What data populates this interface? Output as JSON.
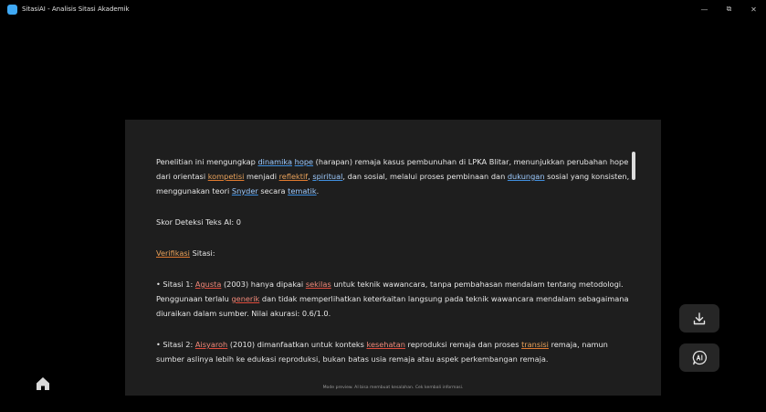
{
  "window": {
    "title": "SitasiAI - Analisis Sitasi Akademik",
    "minimize": "—",
    "maximize": "⧉",
    "close": "✕"
  },
  "content": {
    "p1": {
      "t1": "Penelitian ini mengungkap ",
      "w1": "dinamika",
      "t2": " ",
      "w2": "hope",
      "t3": " (harapan) remaja kasus pembunuhan di LPKA Blitar, menunjukkan perubahan hope dari orientasi ",
      "w3": "kompetisi",
      "t4": " menjadi ",
      "w4": "reflektif",
      "t5": ", ",
      "w5": "spiritual",
      "t6": ", dan sosial, melalui proses pembinaan dan ",
      "w6": "dukungan",
      "t7": " sosial yang konsisten, menggunakan teori ",
      "w7": "Snyder",
      "t8": " secara ",
      "w8": "tematik",
      "t9": "."
    },
    "ai_score": "Skor Deteksi Teks AI: 0",
    "verif": {
      "w1": "Verifikasi",
      "t1": " Sitasi:"
    },
    "s1": {
      "t1": "• Sitasi 1: ",
      "w1": "Agusta",
      "t2": " (2003) hanya dipakai ",
      "w2": "sekilas",
      "t3": " untuk teknik wawancara, tanpa pembahasan mendalam tentang metodologi. Penggunaan terlalu ",
      "w3": "generik",
      "t4": " dan tidak memperlihatkan keterkaitan langsung pada teknik wawancara mendalam sebagaimana diuraikan dalam sumber. Nilai akurasi: 0.6/1.0."
    },
    "s2": {
      "t1": "• Sitasi 2: ",
      "w1": "Aisyaroh",
      "t2": " (2010) dimanfaatkan untuk konteks ",
      "w2": "kesehatan",
      "t3": " reproduksi remaja dan proses ",
      "w3": "transisi",
      "t4": " remaja, namun sumber aslinya lebih ke edukasi reproduksi, bukan batas usia remaja atau aspek perkembangan remaja."
    },
    "footer_note": "Mode preview. AI bisa membuat kesalahan. Cek kembali informasi."
  },
  "colors": {
    "background": "#000000",
    "panel": "#1e1e1e",
    "underline_blue": "#3f8fe0",
    "underline_orange": "#e07a2f",
    "underline_red": "#e04b3b"
  },
  "icons": {
    "app": "app-logo-icon",
    "download": "download-icon",
    "ai": "ai-chat-icon",
    "home": "home-icon"
  }
}
